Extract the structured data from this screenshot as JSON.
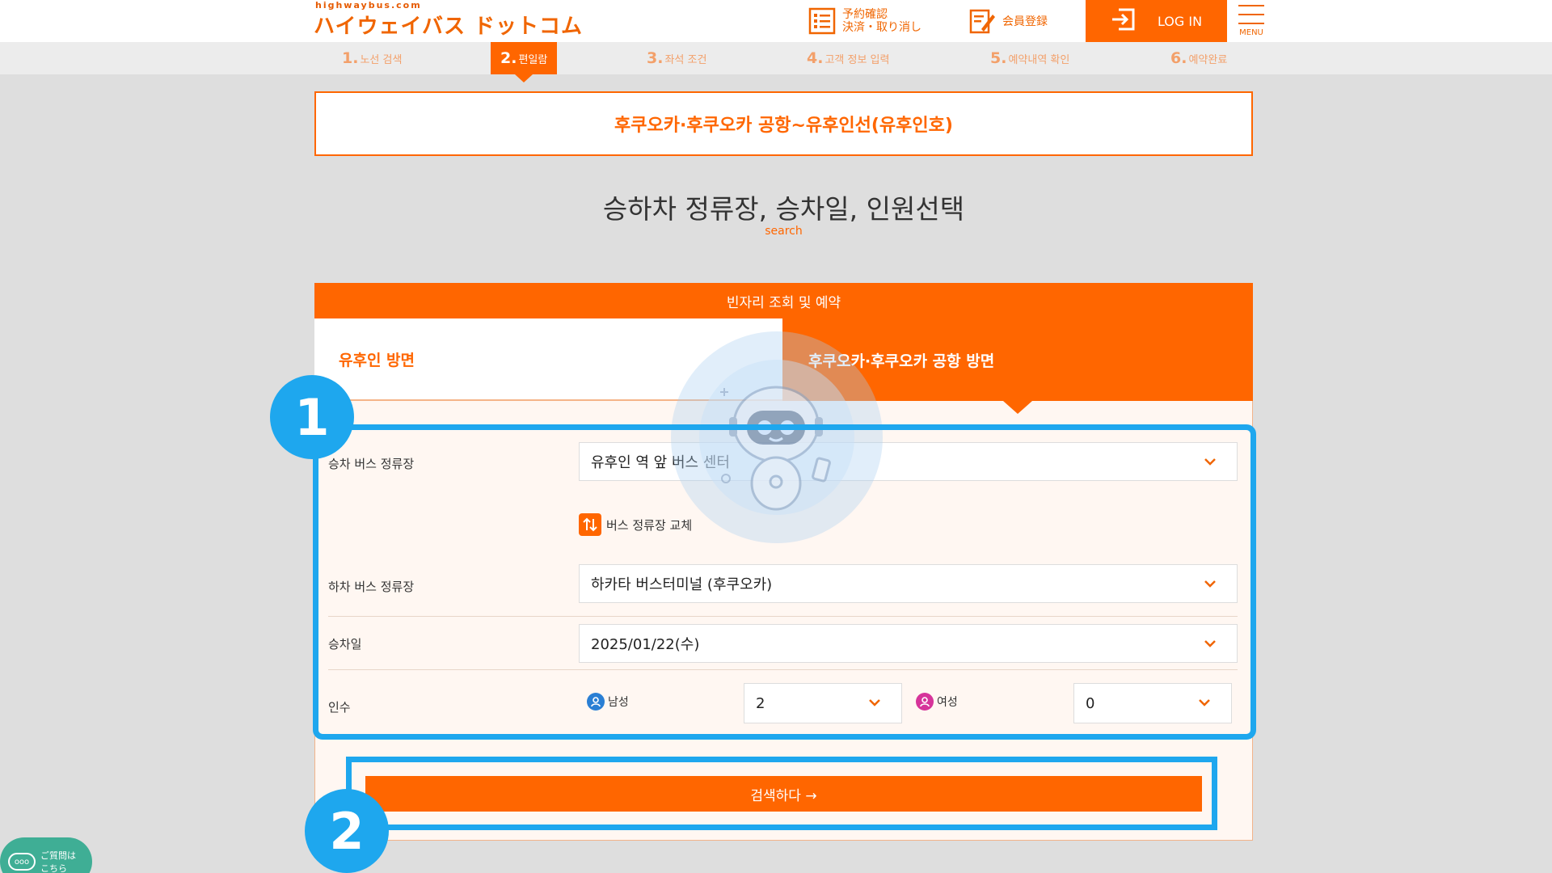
{
  "header": {
    "logo_small": "highwaybus.com",
    "logo_main": "ハイウェイバス ドットコム",
    "reserve_line1": "予約確認",
    "reserve_line2": "決済・取り消し",
    "member": "会員登録",
    "login": "LOG IN",
    "menu": "MENU"
  },
  "steps": [
    {
      "num": "1.",
      "label": "노선 검색"
    },
    {
      "num": "2.",
      "label": "편일람"
    },
    {
      "num": "3.",
      "label": "좌석 조건"
    },
    {
      "num": "4.",
      "label": "고객 정보 입력"
    },
    {
      "num": "5.",
      "label": "예약내역 확인"
    },
    {
      "num": "6.",
      "label": "예약완료"
    }
  ],
  "route_title": "후쿠오카·후쿠오카 공항~유후인선(유후인호)",
  "page_title": "승하차 정류장, 승차일, 인원선택",
  "page_sub": "search",
  "panel": {
    "head": "빈자리 조회 및 예약",
    "tab_left": "유후인 방면",
    "tab_right": "후쿠오카·후쿠오카 공항 방면"
  },
  "form": {
    "board_label": "승차 버스 정류장",
    "board_value": "유후인 역 앞 버스 센터",
    "swap_label": "버스 정류장 교체",
    "alight_label": "하차 버스 정류장",
    "alight_value": "하카타 버스터미널 (후쿠오카)",
    "date_label": "승차일",
    "date_value": "2025/01/22(수)",
    "pax_label": "인수",
    "male_label": "남성",
    "male_value": "2",
    "female_label": "여성",
    "female_value": "0"
  },
  "search_button": "검색하다 →",
  "annotations": {
    "badge1": "1",
    "badge2": "2"
  },
  "chat": {
    "line1": "ご質問は",
    "line2": "こちら",
    "icon_text": "ooo"
  },
  "colors": {
    "accent": "#ff6600",
    "highlight": "#1ea7ee",
    "chat": "#3fae95"
  }
}
